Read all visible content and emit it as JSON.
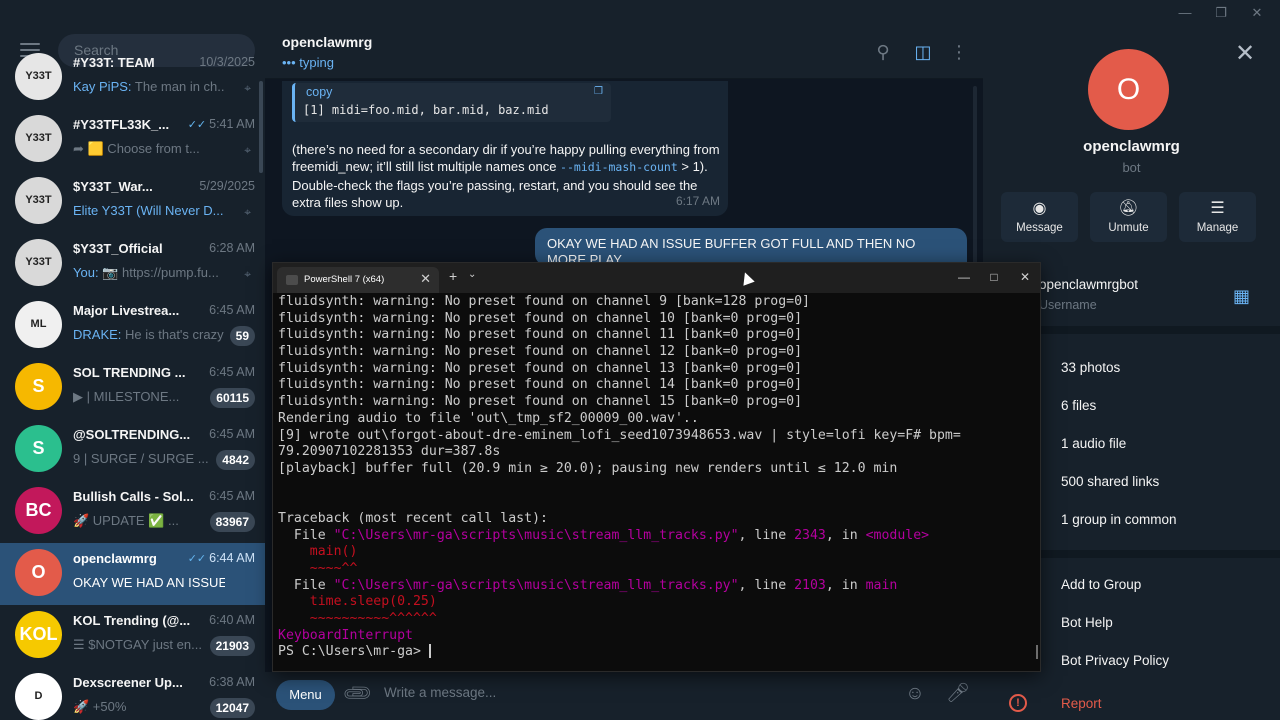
{
  "sidebar": {
    "search_placeholder": "Search",
    "chats": [
      {
        "title": "#Y33T: TEAM",
        "time": "10/3/2025",
        "sender": "Kay PiPS:",
        "preview": " The man in ch...",
        "pinned": true,
        "avatar_color": "#e6e6e6",
        "avatar_text": "Y33T"
      },
      {
        "title": "#Y33TFL33K_...",
        "time": "5:41 AM",
        "sender": "",
        "preview": "➦ 🟨 Choose from t...",
        "pinned": true,
        "avatar_color": "#d9d9d9",
        "avatar_text": "Y33T",
        "checks": true
      },
      {
        "title": "$Y33T_War...",
        "time": "5/29/2025",
        "sender": "Elite Y33T (Will Never D...",
        "preview": "",
        "pinned": true,
        "avatar_color": "#d9d9d9",
        "avatar_text": "Y33T"
      },
      {
        "title": "$Y33T_Official",
        "time": "6:28 AM",
        "sender": "You:",
        "preview": " 📷 https://pump.fu...",
        "pinned": true,
        "avatar_color": "#d9d9d9",
        "avatar_text": "Y33T"
      },
      {
        "title": "Major Livestrea...",
        "time": "6:45 AM",
        "sender": "DRAKE:",
        "preview": " He is that's crazy",
        "badge": "59",
        "avatar_color": "#f0f0f0",
        "avatar_text": "ML"
      },
      {
        "title": "SOL TRENDING ...",
        "time": "6:45 AM",
        "sender": "",
        "preview": "▶ | MILESTONE...",
        "badge": "60115",
        "avatar_color": "#f6b800",
        "avatar_text": "S"
      },
      {
        "title": "@SOLTRENDING...",
        "time": "6:45 AM",
        "sender": "",
        "preview": "9 | SURGE / SURGE ...",
        "badge": "4842",
        "avatar_color": "#2bbf8e",
        "avatar_text": "S"
      },
      {
        "title": "Bullish Calls - Sol...",
        "time": "6:45 AM",
        "sender": "",
        "preview": "🚀 UPDATE ✅ ...",
        "badge": "83967",
        "avatar_color": "#c2185b",
        "avatar_text": "BC"
      },
      {
        "title": "openclawmrg",
        "time": "6:44 AM",
        "sender": "",
        "preview": "OKAY WE HAD AN ISSUE BUF...",
        "active": true,
        "avatar_color": "#e35b4a",
        "avatar_text": "O",
        "checks": true
      },
      {
        "title": "KOL Trending (@...",
        "time": "6:40 AM",
        "sender": "",
        "preview": "☰ $NOTGAY just en...",
        "badge": "21903",
        "avatar_color": "#f6c900",
        "avatar_text": "KOL"
      },
      {
        "title": "Dexscreener Up...",
        "time": "6:38 AM",
        "sender": "",
        "preview": "🚀 +50%",
        "badge": "12047",
        "avatar_color": "#ffffff",
        "avatar_text": "D"
      }
    ]
  },
  "chat": {
    "title": "openclawmrg",
    "status": "typing",
    "code_copy": "copy",
    "code_line": "[1] midi=foo.mid, bar.mid, baz.mid",
    "msg_part1": "(there’s no need for a secondary dir if you’re happy pulling everything from freemidi_new; it’ll still list multiple names once ",
    "msg_code": "--midi-mash-count",
    "msg_part2": " > 1). Double-check the flags you’re passing, restart, and you should see the extra files show up.",
    "msg_time": "6:17 AM",
    "out_message": "OKAY WE HAD AN ISSUE BUFFER GOT FULL AND THEN NO MORE PLAY",
    "menu_label": "Menu",
    "composer_placeholder": "Write a message..."
  },
  "info": {
    "name": "openclawmrg",
    "subtitle": "bot",
    "avatar_letter": "O",
    "actions": [
      {
        "label": "Message",
        "icon": "message-icon"
      },
      {
        "label": "Unmute",
        "icon": "bell-off-icon"
      },
      {
        "label": "Manage",
        "icon": "sliders-icon"
      }
    ],
    "username": "openclawmrgbot",
    "username_label": "Username",
    "media": [
      "33 photos",
      "6 files",
      "1 audio file",
      "500 shared links",
      "1 group in common"
    ],
    "bot_actions": [
      "Add to Group",
      "Bot Help",
      "Bot Privacy Policy"
    ],
    "report": "Report"
  },
  "terminal": {
    "tab_title": "PowerShell 7 (x64)",
    "warnings": [
      "fluidsynth: warning: No preset found on channel 9 [bank=128 prog=0]",
      "fluidsynth: warning: No preset found on channel 10 [bank=0 prog=0]",
      "fluidsynth: warning: No preset found on channel 11 [bank=0 prog=0]",
      "fluidsynth: warning: No preset found on channel 12 [bank=0 prog=0]",
      "fluidsynth: warning: No preset found on channel 13 [bank=0 prog=0]",
      "fluidsynth: warning: No preset found on channel 14 [bank=0 prog=0]",
      "fluidsynth: warning: No preset found on channel 15 [bank=0 prog=0]"
    ],
    "rendering": "Rendering audio to file 'out\\_tmp_sf2_00009_00.wav'..",
    "wrote1": "[9] wrote out\\forgot-about-dre-eminem_lofi_seed1073948653.wav | style=lofi key=F# bpm=",
    "wrote2": "79.20907102281353 dur=387.8s",
    "playback": "[playback] buffer full (20.9 min ≥ 20.0); pausing new renders until ≤ 12.0 min",
    "traceback": "Traceback (most recent call last):",
    "file_word": "File",
    "path": "\"C:\\Users\\mr-ga\\scripts\\music\\stream_llm_tracks.py\"",
    "line_word": ", line ",
    "in_word": ", in ",
    "line1": "2343",
    "func1": "<module>",
    "call1": "main()",
    "caret1": "~~~~^^",
    "line2": "2103",
    "func2": "main",
    "call2": "time.sleep(0.25)",
    "caret2": "~~~~~~~~~~^^^^^^",
    "interrupt": "KeyboardInterrupt",
    "prompt": "PS C:\\Users\\mr-ga> "
  },
  "colors": {
    "accent": "#2b5278",
    "link": "#6ab3f3",
    "danger": "#e35b4a"
  }
}
